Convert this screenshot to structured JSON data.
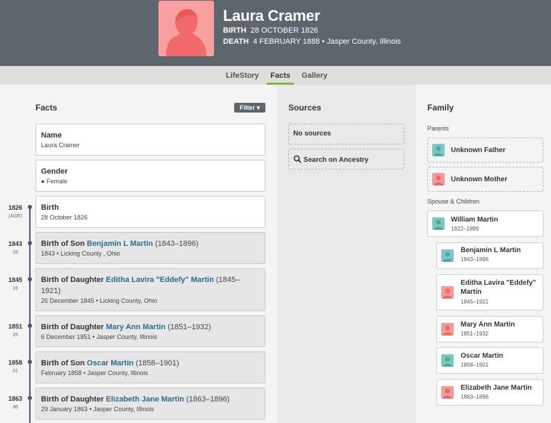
{
  "person": {
    "name": "Laura Cramer",
    "birth_label": "BIRTH",
    "birth_value": "28 OCTOBER 1826",
    "death_label": "DEATH",
    "death_value": "4 FEBRUARY 1888 • Jasper County, Illinois"
  },
  "tabs": {
    "lifestory": "LifeStory",
    "facts": "Facts",
    "gallery": "Gallery"
  },
  "facts": {
    "title": "Facts",
    "filter_label": "Filter",
    "name_label": "Name",
    "name_value": "Laura Cramer",
    "gender_label": "Gender",
    "gender_value": "Female",
    "birth_label": "Birth",
    "birth_value": "28 October 1826",
    "events": [
      {
        "rel": "Birth of Son",
        "person": "Benjamin L Martin",
        "dates": "(1843–1896)",
        "sub": "1843 • Licking County , Ohio"
      },
      {
        "rel": "Birth of Daughter",
        "person": "Editha Lavira \"Eddefy\" Martin",
        "dates": "(1845–",
        "dates2": "1921)",
        "sub": "26 December 1845 • Licking County, Ohio"
      },
      {
        "rel": "Birth of Daughter",
        "person": "Mary Ann Martin",
        "dates": "(1851–1932)",
        "sub": "6 December 1851 • Jasper County, Illinois"
      },
      {
        "rel": "Birth of Son",
        "person": "Oscar Martin",
        "dates": "(1858–1901)",
        "sub": "February 1858 • Jasper County, Illinois"
      },
      {
        "rel": "Birth of Daughter",
        "person": "Elizabeth Jane Martin",
        "dates": "(1863–1896)",
        "sub": "29 January 1863 • Jasper County, Illinois"
      }
    ]
  },
  "timeline": [
    {
      "year": "1826",
      "age": "(AGE)"
    },
    {
      "year": "1843",
      "age": "16"
    },
    {
      "year": "1845",
      "age": "19"
    },
    {
      "year": "1851",
      "age": "25"
    },
    {
      "year": "1858",
      "age": "31"
    },
    {
      "year": "1863",
      "age": "36"
    }
  ],
  "sources": {
    "title": "Sources",
    "none": "No sources",
    "search": "Search on Ancestry"
  },
  "family": {
    "title": "Family",
    "parents_label": "Parents",
    "father": "Unknown Father",
    "mother": "Unknown Mother",
    "spouse_label": "Spouse & Children",
    "spouse": {
      "name": "William Martin",
      "years": "1822–1899"
    },
    "children": [
      {
        "name": "Benjamin L Martin",
        "years": "1843–1896"
      },
      {
        "name": "Editha Lavira \"Eddefy\"",
        "name2": "Martin",
        "years": "1845–1921"
      },
      {
        "name": "Mary Ann Martin",
        "years": "1851–1932"
      },
      {
        "name": "Oscar Martin",
        "years": "1858–1901"
      },
      {
        "name": "Elizabeth Jane Martin",
        "years": "1863–1896"
      }
    ]
  },
  "colors": {
    "header": "#5d656d",
    "accent": "#7fb83d",
    "link": "#2d6b8e",
    "male": "#7cc8c2",
    "female": "#f49a9a",
    "timeline": "#5b4a7a"
  }
}
